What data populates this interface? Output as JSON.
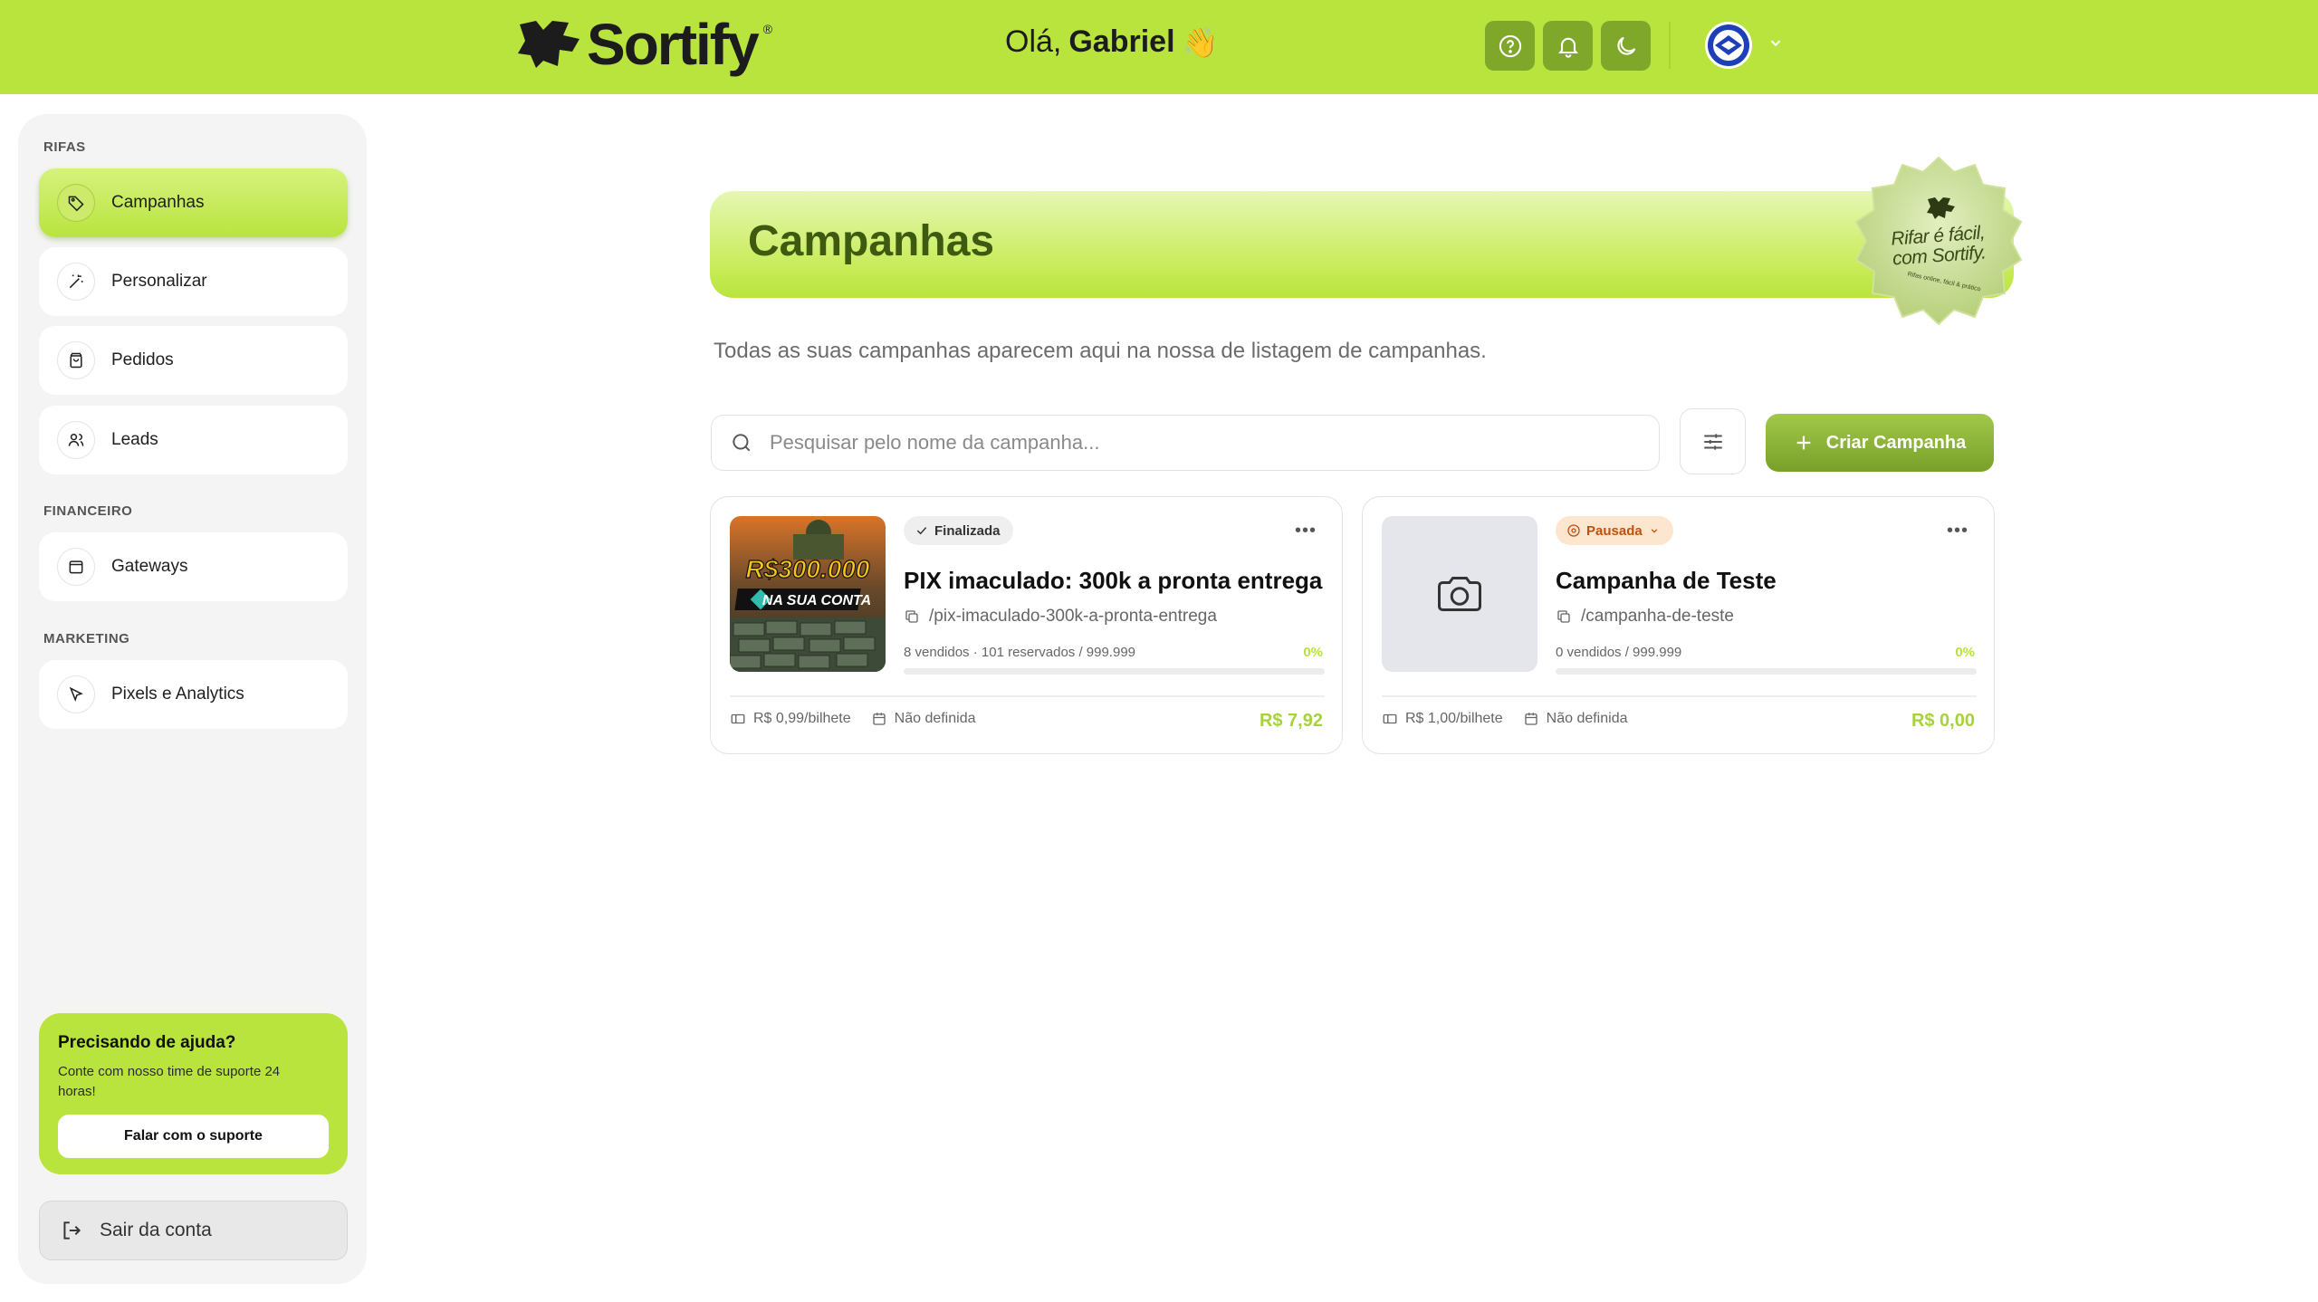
{
  "header": {
    "brand": "Sortify",
    "brand_reg": "®",
    "greeting_prefix": "Olá,",
    "user_name": "Gabriel",
    "wave": "👋"
  },
  "colors": {
    "brand_green": "#b9e43e",
    "dark_green_button": "#7fa82a",
    "title_green": "#3d5a10",
    "paused_orange": "#c0510f"
  },
  "sidebar": {
    "sections": [
      {
        "label": "RIFAS",
        "items": [
          {
            "label": "Campanhas",
            "icon": "tag-icon",
            "active": true
          },
          {
            "label": "Personalizar",
            "icon": "magic-wand-icon",
            "active": false
          },
          {
            "label": "Pedidos",
            "icon": "shopping-bag-icon",
            "active": false
          },
          {
            "label": "Leads",
            "icon": "users-icon",
            "active": false
          }
        ]
      },
      {
        "label": "FINANCEIRO",
        "items": [
          {
            "label": "Gateways",
            "icon": "wallet-icon",
            "active": false
          }
        ]
      },
      {
        "label": "MARKETING",
        "items": [
          {
            "label": "Pixels e Analytics",
            "icon": "cursor-icon",
            "active": false
          }
        ]
      }
    ],
    "help": {
      "title": "Precisando de ajuda?",
      "text": "Conte com nosso time de suporte 24 horas!",
      "button": "Falar com o suporte"
    },
    "logout": "Sair da conta"
  },
  "main": {
    "title": "Campanhas",
    "badge_text_line1": "Rifar é fácil,",
    "badge_text_line2": "com Sortify.",
    "badge_small": "Rifas online, fácil & prático",
    "subtitle": "Todas as suas campanhas aparecem aqui na nossa de listagem de campanhas.",
    "search_placeholder": "Pesquisar pelo nome da campanha...",
    "create_button": "Criar Campanha",
    "campaigns": [
      {
        "status": "Finalizada",
        "title": "PIX imaculado: 300k a pronta entrega",
        "slug": "/pix-imaculado-300k-a-pronta-entrega",
        "stats": "8 vendidos · 101 reservados / 999.999",
        "percent": "0%",
        "progress": 0.0,
        "price": "R$ 0,99/bilhete",
        "date": "Não definida",
        "total": "R$ 7,92",
        "thumb_line1": "R$300.000",
        "thumb_line2": "NA SUA CONTA"
      },
      {
        "status": "Pausada",
        "title": "Campanha de Teste",
        "slug": "/campanha-de-teste",
        "stats": "0 vendidos / 999.999",
        "percent": "0%",
        "progress": 0.0,
        "price": "R$ 1,00/bilhete",
        "date": "Não definida",
        "total": "R$ 0,00"
      }
    ]
  }
}
